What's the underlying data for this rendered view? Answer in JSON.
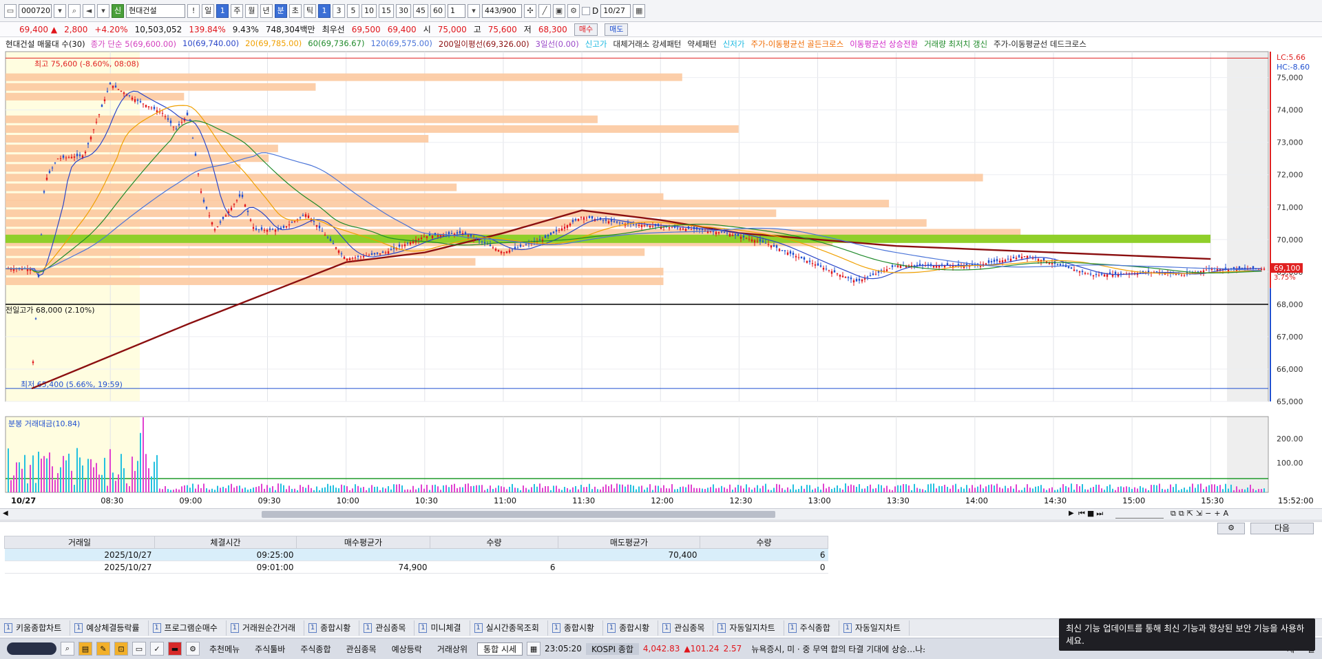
{
  "toolbar": {
    "code": "000720",
    "badge": "신",
    "name": "현대건설",
    "alert": "!",
    "periods": [
      "일",
      "1",
      "주",
      "월",
      "년",
      "분",
      "초",
      "틱"
    ],
    "intervals": [
      "1",
      "3",
      "5",
      "10",
      "15",
      "30",
      "45",
      "60"
    ],
    "count_sel": "1",
    "range": "443",
    "range_total": "/900",
    "date_d": "D",
    "date_value": "10/27"
  },
  "quote": {
    "price": "69,400",
    "arrow": "▲",
    "change": "2,800",
    "rate": "+4.20%",
    "volume": "10,503,052",
    "vol_rate": "139.84%",
    "turnover": "9.43%",
    "amount": "748,304백만",
    "sell_label": "최우선",
    "bid": "69,500",
    "ask": "69,400",
    "open_label": "시",
    "open": "75,000",
    "high_label": "고",
    "high": "75,600",
    "low_label": "저",
    "low": "68,300",
    "buy_btn": "매수",
    "sell_btn": "매도"
  },
  "legend": {
    "title": "현대건설 매물대 수(30)",
    "items": [
      {
        "text": "종가 단순 5(69,600.00)",
        "color": "#d23fbe"
      },
      {
        "text": "10(69,740.00)",
        "color": "#2a46c8"
      },
      {
        "text": "20(69,785.00)",
        "color": "#f0a000"
      },
      {
        "text": "60(69,736.67)",
        "color": "#1f8a2a"
      },
      {
        "text": "120(69,575.00)",
        "color": "#4a74d8"
      },
      {
        "text": "200일이평선(69,326.00)",
        "color": "#8b0f10"
      },
      {
        "text": "3일선(0.00)",
        "color": "#9a48c8"
      },
      {
        "text": "신고가",
        "color": "#18b8e0"
      },
      {
        "text": "대체거래소 강세패턴",
        "color": "#222222"
      },
      {
        "text": "약세패턴",
        "color": "#222222"
      },
      {
        "text": "신저가",
        "color": "#18b8e0"
      },
      {
        "text": "주가-이동평균선 골든크로스",
        "color": "#f06a00"
      },
      {
        "text": "이동평균선 상승전환",
        "color": "#d026c8"
      },
      {
        "text": "거래량 최저치 갱신",
        "color": "#1f8a2a"
      },
      {
        "text": "주가-이동평균선 데드크로스",
        "color": "#222222"
      }
    ],
    "lc": "LC:5.66",
    "hc": "HC:-8.60"
  },
  "chart_data": {
    "type": "candlestick",
    "y_ticks": [
      "75,000",
      "74,000",
      "73,000",
      "72,000",
      "71,000",
      "70,000",
      "69,000",
      "68,000",
      "67,000",
      "66,000",
      "65,000"
    ],
    "ylim": [
      65000,
      75800
    ],
    "last_price_tag": "69,100",
    "last_rate_tag": "3.75%",
    "high_note": "최고 75,600 (-8.60%, 08:08)",
    "low_note": "최저 65,400 (5.66%, 19:59)",
    "prev_high_note": "전일고가 68,000 (2.10%)",
    "volume_title": "분봉 거래대금(10.84)",
    "volume_ticks": [
      "200.00",
      "100.00"
    ],
    "x_ticks": [
      "10/27",
      "08:30",
      "09:00",
      "09:30",
      "10:00",
      "10:30",
      "11:00",
      "11:30",
      "12:00",
      "12:30",
      "13:00",
      "13:30",
      "14:00",
      "14:30",
      "15:00",
      "15:30"
    ],
    "end_time": "15:52:00",
    "volume_profile": [
      {
        "price": 75000,
        "len": 0.72
      },
      {
        "price": 74700,
        "len": 0.33
      },
      {
        "price": 74400,
        "len": 0.19
      },
      {
        "price": 73700,
        "len": 0.63
      },
      {
        "price": 73400,
        "len": 0.78
      },
      {
        "price": 73100,
        "len": 0.45
      },
      {
        "price": 72800,
        "len": 0.29
      },
      {
        "price": 72500,
        "len": 0.28
      },
      {
        "price": 72200,
        "len": 0.25
      },
      {
        "price": 71900,
        "len": 1.04
      },
      {
        "price": 71600,
        "len": 0.48
      },
      {
        "price": 71300,
        "len": 0.7
      },
      {
        "price": 71100,
        "len": 0.94
      },
      {
        "price": 70800,
        "len": 0.82
      },
      {
        "price": 70500,
        "len": 0.98
      },
      {
        "price": 70200,
        "len": 1.08
      },
      {
        "price": 69900,
        "len": 0.88
      },
      {
        "price": 69600,
        "len": 0.68
      },
      {
        "price": 69300,
        "len": 0.5
      },
      {
        "price": 69000,
        "len": 0.7
      },
      {
        "price": 68700,
        "len": 0.7
      }
    ],
    "price_path": [
      {
        "t": "08:00",
        "p": 65600
      },
      {
        "t": "08:05",
        "p": 71800
      },
      {
        "t": "08:10",
        "p": 72500
      },
      {
        "t": "08:20",
        "p": 72600
      },
      {
        "t": "08:30",
        "p": 74800
      },
      {
        "t": "08:40",
        "p": 74300
      },
      {
        "t": "08:50",
        "p": 73900
      },
      {
        "t": "08:55",
        "p": 73400
      },
      {
        "t": "09:00",
        "p": 73900
      },
      {
        "t": "09:05",
        "p": 71300
      },
      {
        "t": "09:10",
        "p": 70300
      },
      {
        "t": "09:20",
        "p": 71400
      },
      {
        "t": "09:25",
        "p": 70300
      },
      {
        "t": "09:35",
        "p": 70300
      },
      {
        "t": "09:45",
        "p": 70800
      },
      {
        "t": "10:00",
        "p": 69400
      },
      {
        "t": "10:15",
        "p": 69600
      },
      {
        "t": "10:30",
        "p": 70100
      },
      {
        "t": "10:45",
        "p": 70200
      },
      {
        "t": "11:00",
        "p": 69600
      },
      {
        "t": "11:15",
        "p": 70000
      },
      {
        "t": "11:30",
        "p": 70700
      },
      {
        "t": "11:45",
        "p": 70500
      },
      {
        "t": "12:00",
        "p": 70400
      },
      {
        "t": "12:15",
        "p": 70300
      },
      {
        "t": "12:25",
        "p": 70200
      },
      {
        "t": "12:40",
        "p": 69900
      },
      {
        "t": "13:00",
        "p": 69200
      },
      {
        "t": "13:15",
        "p": 68700
      },
      {
        "t": "13:30",
        "p": 69200
      },
      {
        "t": "14:00",
        "p": 69200
      },
      {
        "t": "14:20",
        "p": 69500
      },
      {
        "t": "14:45",
        "p": 68900
      },
      {
        "t": "15:10",
        "p": 69000
      },
      {
        "t": "15:20",
        "p": 68900
      },
      {
        "t": "15:30",
        "p": 69100
      },
      {
        "t": "15:52",
        "p": 69100
      }
    ],
    "ma200_path": [
      {
        "t": "08:00",
        "p": 65400
      },
      {
        "t": "09:00",
        "p": 67400
      },
      {
        "t": "10:00",
        "p": 69300
      },
      {
        "t": "10:30",
        "p": 69600
      },
      {
        "t": "11:00",
        "p": 70200
      },
      {
        "t": "11:30",
        "p": 70900
      },
      {
        "t": "12:00",
        "p": 70600
      },
      {
        "t": "12:30",
        "p": 70200
      },
      {
        "t": "13:30",
        "p": 69800
      },
      {
        "t": "14:30",
        "p": 69600
      },
      {
        "t": "15:30",
        "p": 69400
      }
    ]
  },
  "trades": {
    "headers": [
      "거래일",
      "체결시간",
      "매수평균가",
      "수량",
      "매도평균가",
      "수량"
    ],
    "rows": [
      [
        "2025/10/27",
        "09:25:00",
        "",
        "",
        "70,400",
        "6"
      ],
      [
        "2025/10/27",
        "09:01:00",
        "74,900",
        "6",
        "",
        "0"
      ]
    ],
    "next": "다음"
  },
  "win_tabs": [
    {
      "num": "1",
      "label": "키움종합차트"
    },
    {
      "num": "1",
      "label": "예상체결등락률"
    },
    {
      "num": "1",
      "label": "프로그램순매수"
    },
    {
      "num": "1",
      "label": "거래원순간거래"
    },
    {
      "num": "1",
      "label": "종합시황"
    },
    {
      "num": "1",
      "label": "관심종목"
    },
    {
      "num": "1",
      "label": "미니체결"
    },
    {
      "num": "1",
      "label": "실시간종목조회"
    },
    {
      "num": "1",
      "label": "종합시황"
    },
    {
      "num": "1",
      "label": "종합시황"
    },
    {
      "num": "1",
      "label": "관심종목"
    },
    {
      "num": "1",
      "label": "자동일지차트"
    },
    {
      "num": "1",
      "label": "주식종합"
    },
    {
      "num": "1",
      "label": "자동일지차트"
    }
  ],
  "taskbar": {
    "menu": "추천메뉴",
    "toolbar": "주식툴바",
    "items": [
      "주식종합",
      "관심종목",
      "예상등락",
      "거래상위"
    ],
    "unified": "통합",
    "quote": "시세",
    "clock": "23:05:20",
    "index_name": "KOSPI 종합",
    "index_value": "4,042.83",
    "index_change": "▲101.24",
    "index_rate": "2.57",
    "ticker": "뉴욕증시, 미 · 중 무역 합의 타결 기대에 상승…나스",
    "right": [
      "체",
      "갈"
    ]
  },
  "notice": {
    "text": "최신 기능 업데이트를 통해 최신 기능과 향상된 보안 기능을 사용하세요."
  }
}
